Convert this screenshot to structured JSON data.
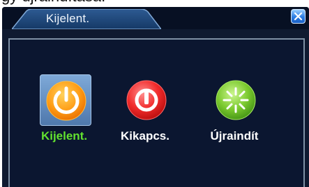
{
  "background_caption": "gy újraindítása:",
  "dialog": {
    "title": "Kijelent.",
    "options": [
      {
        "label": "Kijelent.",
        "icon": "power-icon",
        "selected": true,
        "label_color": "#62e12f"
      },
      {
        "label": "Kikapcs.",
        "icon": "shutdown-icon",
        "selected": false,
        "label_color": "#ffffff"
      },
      {
        "label": "Újraindít",
        "icon": "restart-icon",
        "selected": false,
        "label_color": "#ffffff"
      }
    ]
  },
  "colors": {
    "dialog_bg": "#0f1a30",
    "frame_border": "#7f91a5",
    "accent_blue": "#2b7de3",
    "selected_text": "#62e12f"
  }
}
